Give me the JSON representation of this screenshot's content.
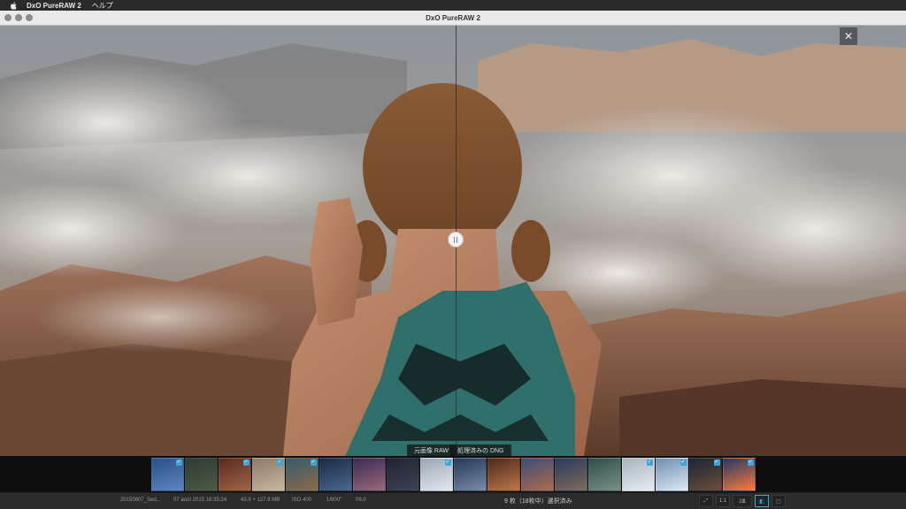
{
  "menubar": {
    "app_name": "DxO PureRAW 2",
    "help": "ヘルプ"
  },
  "window": {
    "title": "DxO PureRAW 2"
  },
  "viewer": {
    "close_glyph": "✕",
    "left_label": "元画像 RAW",
    "right_label": "処理済みの DNG"
  },
  "status": {
    "filename": "20150807_Sed...",
    "date": "07 août 2015 18:35:24",
    "size": "43.9 + 127.8 MB",
    "iso": "ISO 400",
    "shutter": "1/800\"",
    "aperture": "f/8.0",
    "selection": "9 枚（18枚中）選択済み",
    "zoom_fit": "1:1",
    "zoom_level": "2:1"
  },
  "icons": {
    "menu": "apple-icon",
    "split": "split-handle-icon",
    "tools": [
      "fit-screen-icon",
      "split-view-icon",
      "side-by-side-icon"
    ]
  },
  "colors": {
    "accent": "#3aa6d9"
  }
}
